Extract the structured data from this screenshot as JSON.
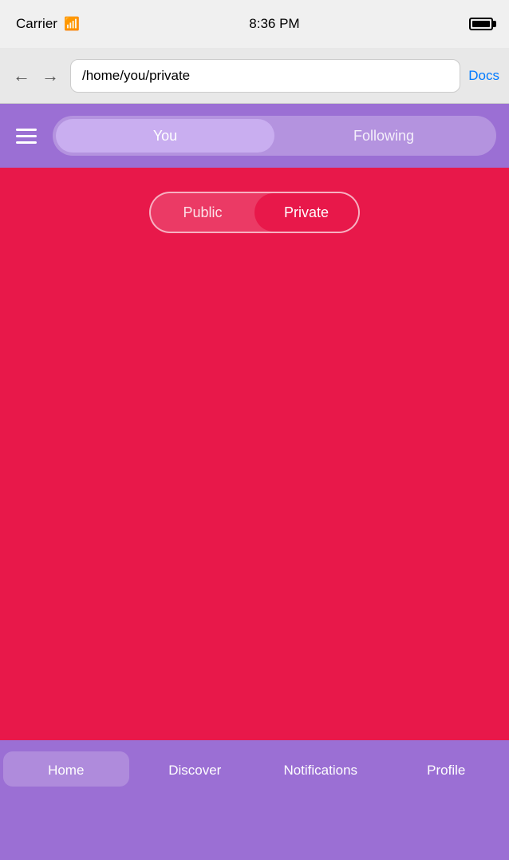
{
  "statusBar": {
    "carrier": "Carrier",
    "time": "8:36 PM"
  },
  "browserBar": {
    "url": "/home/you/private",
    "docsLabel": "Docs",
    "backArrow": "←",
    "forwardArrow": "→"
  },
  "header": {
    "tabs": [
      {
        "id": "you",
        "label": "You",
        "active": true
      },
      {
        "id": "following",
        "label": "Following",
        "active": false
      }
    ]
  },
  "content": {
    "subtabs": [
      {
        "id": "public",
        "label": "Public",
        "active": false
      },
      {
        "id": "private",
        "label": "Private",
        "active": true
      }
    ]
  },
  "bottomNav": {
    "items": [
      {
        "id": "home",
        "label": "Home",
        "active": true
      },
      {
        "id": "discover",
        "label": "Discover",
        "active": false
      },
      {
        "id": "notifications",
        "label": "Notifications",
        "active": false
      },
      {
        "id": "profile",
        "label": "Profile",
        "active": false
      }
    ]
  },
  "colors": {
    "purple": "#9b6fd4",
    "red": "#e8184a",
    "white": "#ffffff"
  }
}
